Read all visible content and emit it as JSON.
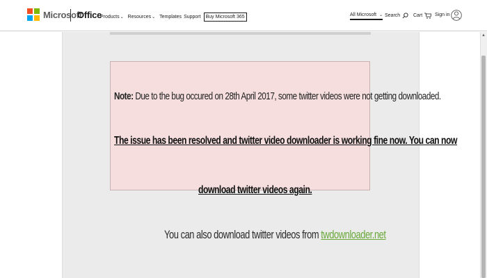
{
  "header": {
    "brand": "Microsoft",
    "product": "Office",
    "nav": [
      {
        "label": "Products",
        "chevron": true
      },
      {
        "label": "Resources",
        "chevron": true
      },
      {
        "label": "Templates",
        "chevron": false
      },
      {
        "label": "Support",
        "chevron": false
      }
    ],
    "buy_label": "Buy Microsoft 365",
    "all_microsoft": "All Microsoft",
    "search_label": "Search",
    "cart_label": "Cart",
    "signin_label": "Sign in",
    "logo_colors": [
      "#f25022",
      "#7fba00",
      "#00a4ef",
      "#ffb900"
    ]
  },
  "notice": {
    "note_label": "Note:",
    "note_text": "Due to the bug occured on 28th April 2017, some twitter videos were not getting downloaded.",
    "resolved_line1": "The issue has been resolved and twitter video downloader is working fine now. You can now",
    "resolved_line2": "download twitter videos again."
  },
  "footer": {
    "also_text": "You can also download twitter videos from ",
    "link_text": "twdownloader.net",
    "link_color": "#6aa83a"
  }
}
